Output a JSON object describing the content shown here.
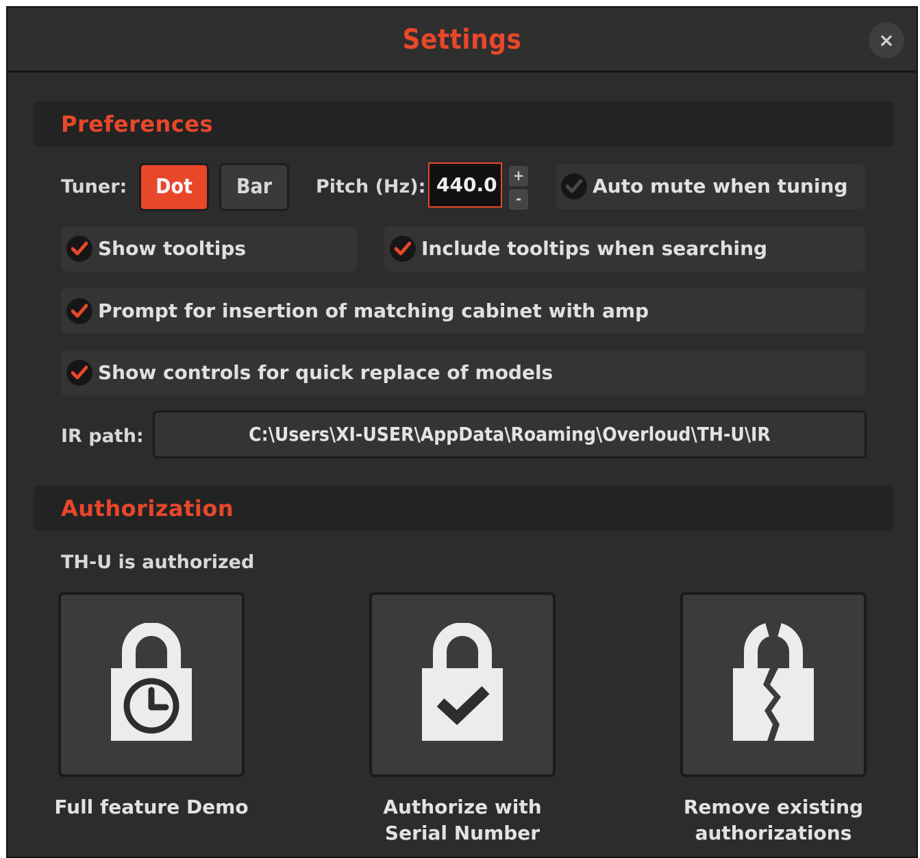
{
  "window": {
    "title": "Settings",
    "close_label": "×"
  },
  "preferences": {
    "heading": "Preferences",
    "tuner_label": "Tuner:",
    "tuner_options": [
      "Dot",
      "Bar"
    ],
    "tuner_selected": "Dot",
    "pitch_label": "Pitch (Hz):",
    "pitch_value": "440.0",
    "pitch_plus": "+",
    "pitch_minus": "-",
    "options": {
      "auto_mute": {
        "label": "Auto mute when tuning",
        "checked": false
      },
      "show_tooltips": {
        "label": "Show tooltips",
        "checked": true
      },
      "include_tooltips": {
        "label": "Include tooltips when searching",
        "checked": true
      },
      "prompt_cabinet": {
        "label": "Prompt for insertion of matching cabinet with amp",
        "checked": true
      },
      "quick_replace": {
        "label": "Show controls for quick replace of models",
        "checked": true
      }
    },
    "ir_path_label": "IR path:",
    "ir_path_value": "C:\\Users\\XI-USER\\AppData\\Roaming\\Overloud\\TH-U\\IR"
  },
  "authorization": {
    "heading": "Authorization",
    "status": "TH-U is authorized",
    "buttons": [
      {
        "icon": "lock-clock-icon",
        "label_lines": [
          "Full feature Demo"
        ]
      },
      {
        "icon": "lock-check-icon",
        "label_lines": [
          "Authorize with",
          "Serial Number"
        ]
      },
      {
        "icon": "broken-lock-icon",
        "label_lines": [
          "Remove existing",
          "authorizations"
        ]
      }
    ]
  },
  "colors": {
    "accent": "#e8472a",
    "background": "#2c2c2c",
    "panel": "#343434",
    "text": "#e0e0e0"
  }
}
